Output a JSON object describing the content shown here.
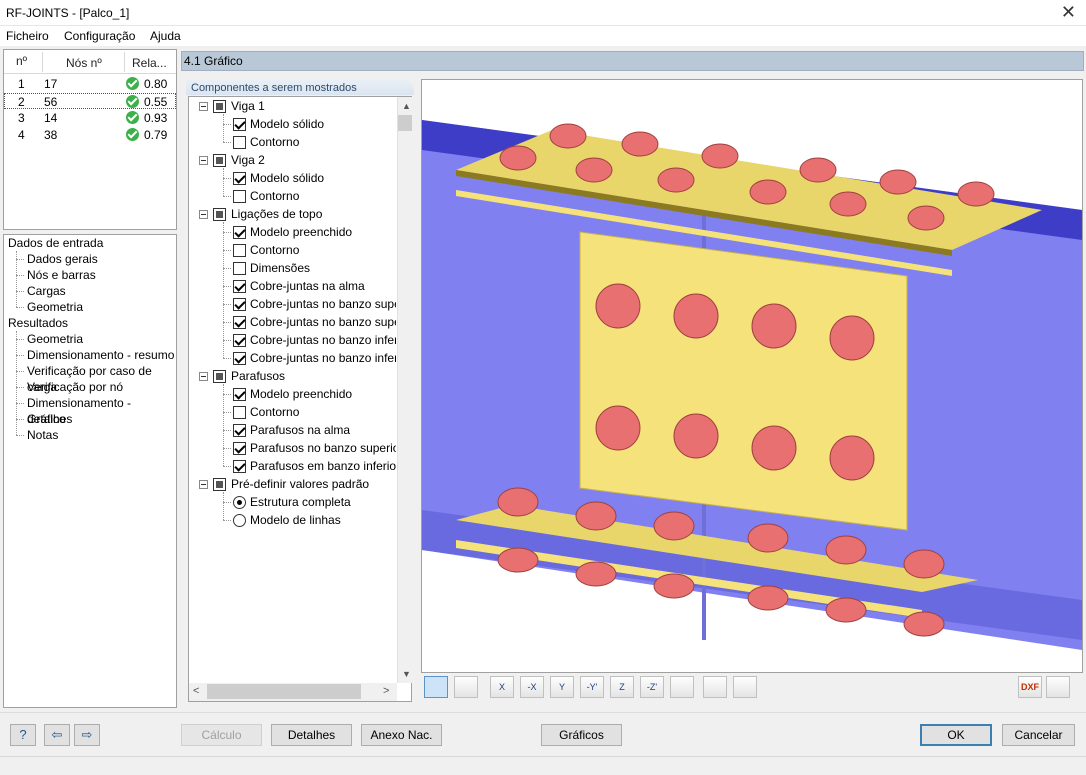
{
  "window": {
    "title": "RF-JOINTS - [Palco_1]",
    "close_glyph": "✕"
  },
  "menu": [
    "Ficheiro",
    "Configuração",
    "Ajuda"
  ],
  "nodes_table": {
    "headers": [
      "nº",
      "Nós nº",
      "Rela..."
    ],
    "rows": [
      {
        "n": "1",
        "node": "17",
        "ratio": "0.80"
      },
      {
        "n": "2",
        "node": "56",
        "ratio": "0.55"
      },
      {
        "n": "3",
        "node": "14",
        "ratio": "0.93"
      },
      {
        "n": "4",
        "node": "38",
        "ratio": "0.79"
      }
    ]
  },
  "nav": {
    "input_group": "Dados de entrada",
    "input_items": [
      "Dados gerais",
      "Nós e barras",
      "Cargas",
      "Geometria"
    ],
    "results_group": "Resultados",
    "results_items": [
      "Geometria",
      "Dimensionamento - resumo",
      "Verificação por caso de carga",
      "Verificação por nó",
      "Dimensionamento - detalhes",
      "Gráfico",
      "Notas"
    ]
  },
  "main": {
    "header": "4.1 Gráfico",
    "components_label": "Componentes a serem mostrados"
  },
  "components": {
    "viga1": {
      "label": "Viga 1",
      "items": [
        {
          "label": "Modelo sólido",
          "checked": true
        },
        {
          "label": "Contorno",
          "checked": false
        }
      ]
    },
    "viga2": {
      "label": "Viga 2",
      "items": [
        {
          "label": "Modelo sólido",
          "checked": true
        },
        {
          "label": "Contorno",
          "checked": false
        }
      ]
    },
    "ligacoes": {
      "label": "Ligações de topo",
      "items": [
        {
          "label": "Modelo preenchido",
          "checked": true
        },
        {
          "label": "Contorno",
          "checked": false
        },
        {
          "label": "Dimensões",
          "checked": false
        },
        {
          "label": "Cobre-juntas na alma",
          "checked": true
        },
        {
          "label": "Cobre-juntas no banzo superior",
          "checked": true
        },
        {
          "label": "Cobre-juntas no banzo superior",
          "checked": true
        },
        {
          "label": "Cobre-juntas no banzo inferior",
          "checked": true
        },
        {
          "label": "Cobre-juntas no banzo inferior",
          "checked": true
        }
      ]
    },
    "parafusos": {
      "label": "Parafusos",
      "items": [
        {
          "label": "Modelo preenchido",
          "checked": true
        },
        {
          "label": "Contorno",
          "checked": false
        },
        {
          "label": "Parafusos na alma",
          "checked": true
        },
        {
          "label": "Parafusos no banzo superior",
          "checked": true
        },
        {
          "label": "Parafusos em banzo inferior",
          "checked": true
        }
      ]
    },
    "predefinir": {
      "label": "Pré-definir valores padrão",
      "items": [
        {
          "label": "Estrutura completa",
          "selected": true
        },
        {
          "label": "Modelo de linhas",
          "selected": false
        }
      ]
    }
  },
  "view_toolbar": [
    "",
    "",
    "X",
    "-X",
    "Y",
    "-Y'",
    "Z",
    "-Z'",
    "",
    "",
    "",
    "DXF",
    ""
  ],
  "buttons": {
    "calculo": "Cálculo",
    "detalhes": "Detalhes",
    "anexo": "Anexo Nac.",
    "graficos": "Gráficos",
    "ok": "OK",
    "cancelar": "Cancelar"
  },
  "colors": {
    "beam": "#8080f0",
    "plate": "#f5e27a",
    "bolt": "#e87070",
    "header": "#b9c8d6"
  }
}
